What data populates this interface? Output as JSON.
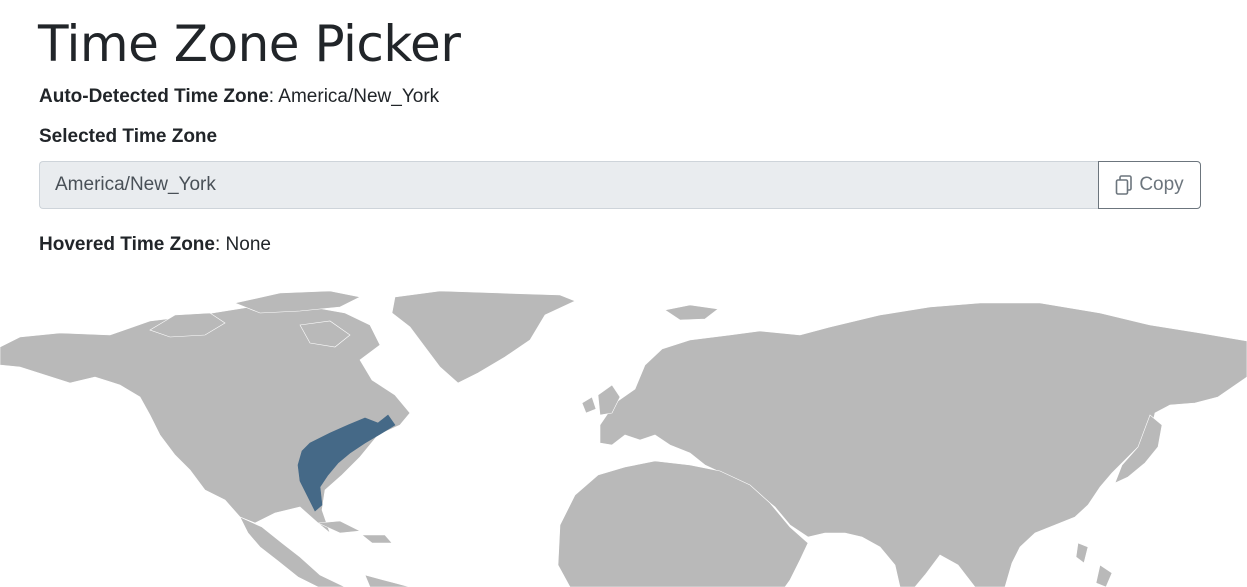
{
  "page": {
    "title": "Time Zone Picker"
  },
  "auto_detected": {
    "label": "Auto-Detected Time Zone",
    "separator": ": ",
    "value": "America/New_York"
  },
  "selected": {
    "label": "Selected Time Zone",
    "value": "America/New_York",
    "copy_label": "Copy",
    "copy_icon": "copy-icon"
  },
  "hovered": {
    "label": "Hovered Time Zone",
    "separator": ": ",
    "value": "None"
  },
  "map": {
    "selected_zone": "America/New_York",
    "colors": {
      "land": "#b9b9b9",
      "selected": "#456987"
    }
  }
}
